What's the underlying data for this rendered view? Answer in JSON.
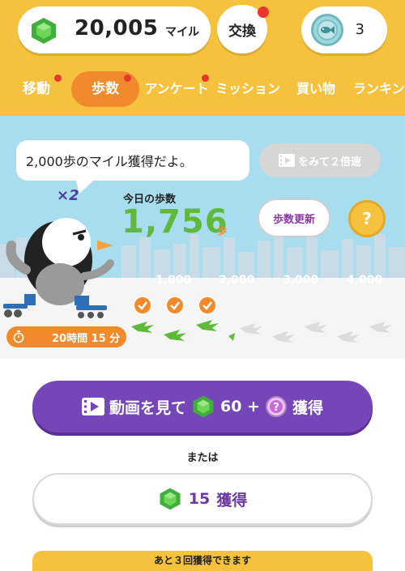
{
  "header": {
    "miles": {
      "value": "20,005",
      "unit": "マイル",
      "icon": "green-gem-icon"
    },
    "exchange": {
      "label": "交換",
      "has_notification": true
    },
    "coins": {
      "count": "3",
      "icon": "fish-coin-icon"
    }
  },
  "tabs": [
    {
      "label": "移動",
      "active": false,
      "notification": true
    },
    {
      "label": "歩数",
      "active": true,
      "notification": true
    },
    {
      "label": "アンケート",
      "active": false,
      "notification": true
    },
    {
      "label": "ミッション",
      "active": false,
      "notification": false
    },
    {
      "label": "買い物",
      "active": false,
      "notification": false
    },
    {
      "label": "ランキン",
      "active": false,
      "notification": false
    }
  ],
  "scene": {
    "bubble_text": "2,000歩のマイル獲得だよ。",
    "double_button": {
      "label": "をみて２倍速",
      "icon": "video-icon"
    },
    "multiplier": "×2",
    "today_label": "今日の歩数",
    "steps": "1,756",
    "steps_unit": "歩",
    "update_button": "歩数更新",
    "help_button": "?",
    "milestones": [
      "1,000",
      "2,000",
      "3,000",
      "4,000"
    ],
    "checks_completed": 3,
    "timer": {
      "icon": "stopwatch-icon",
      "text": "20時間 15 分"
    }
  },
  "actions": {
    "video_button": {
      "prefix": "動画を見て",
      "amount": "60 +",
      "suffix": "獲得",
      "icon": "video-icon"
    },
    "or_label": "または",
    "claim_button": {
      "amount": "15",
      "suffix": "獲得"
    },
    "remaining_text": "あと３回獲得できます"
  },
  "colors": {
    "header_bg": "#f6c23e",
    "active_tab": "#f08a2c",
    "steps_green": "#5fb93a",
    "video_button": "#7446b8",
    "sky": "#a8dcef"
  }
}
